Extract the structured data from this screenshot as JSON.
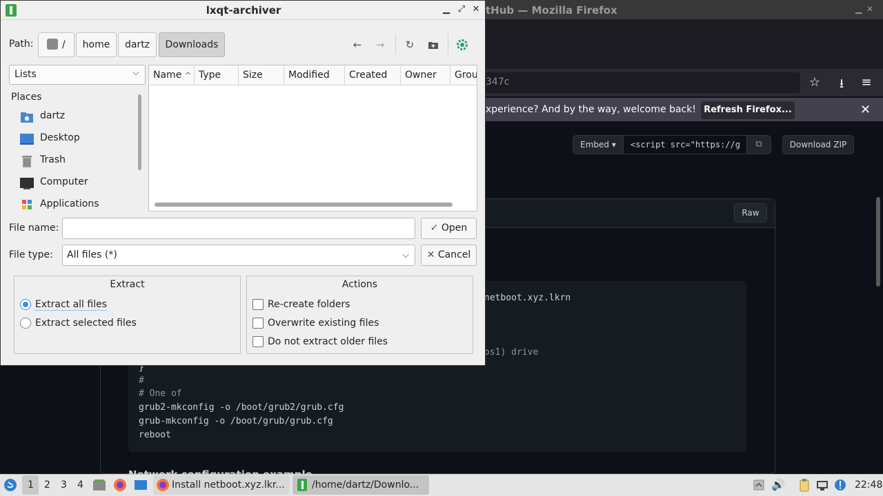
{
  "firefox": {
    "title": "tHub — Mozilla Firefox",
    "url_fragment": "347c",
    "notification_text": "xperience? And by the way, welcome back!",
    "refresh_button": "Refresh Firefox...",
    "embed_button": "Embed ▾",
    "embed_value": "<script src=\"https://g",
    "download_zip": "Download ZIP",
    "raw_button": "Raw",
    "code_fragments": {
      "line1": "netboot.xyz.lkrn",
      "line2": "os1) drive"
    },
    "code_lines": [
      {
        "text": "}",
        "comment": false
      },
      {
        "text": "#",
        "comment": true
      },
      {
        "text": "# One of",
        "comment": true
      },
      {
        "text": "grub2-mkconfig -o /boot/grub2/grub.cfg",
        "comment": false
      },
      {
        "text": "grub-mkconfig -o /boot/grub/grub.cfg",
        "comment": false
      },
      {
        "text": "reboot",
        "comment": false
      }
    ],
    "heading_below": "Network configuration example"
  },
  "dialog": {
    "title": "lxqt-archiver",
    "path_label": "Path:",
    "path_crumbs": [
      "/",
      "home",
      "dartz",
      "Downloads"
    ],
    "active_crumb": "Downloads",
    "places_view": "Lists",
    "places_heading": "Places",
    "places": [
      {
        "label": "dartz",
        "icon": "home-folder-icon"
      },
      {
        "label": "Desktop",
        "icon": "desktop-icon"
      },
      {
        "label": "Trash",
        "icon": "trash-icon"
      },
      {
        "label": "Computer",
        "icon": "computer-icon"
      },
      {
        "label": "Applications",
        "icon": "applications-icon"
      }
    ],
    "columns": [
      "Name",
      "Type",
      "Size",
      "Modified",
      "Created",
      "Owner",
      "Group"
    ],
    "sort_column": "Name",
    "file_name_label": "File name:",
    "file_name_value": "",
    "file_type_label": "File type:",
    "file_type_value": "All files (*)",
    "open_button": "Open",
    "cancel_button": "Cancel",
    "extract_group": {
      "title": "Extract",
      "options": [
        {
          "label": "Extract all files",
          "checked": true
        },
        {
          "label": "Extract selected files",
          "checked": false
        }
      ]
    },
    "actions_group": {
      "title": "Actions",
      "options": [
        {
          "label": "Re-create folders",
          "checked": false
        },
        {
          "label": "Overwrite existing files",
          "checked": false
        },
        {
          "label": "Do not extract older files",
          "checked": false
        }
      ]
    }
  },
  "taskbar": {
    "workspaces": [
      "1",
      "2",
      "3",
      "4"
    ],
    "active_workspace": "1",
    "tasks": [
      {
        "label": "Install netboot.xyz.lkr...",
        "icon": "firefox-icon"
      },
      {
        "label": "/home/dartz/Downlo...",
        "icon": "archiver-icon"
      }
    ],
    "clock": "22:48"
  },
  "colors": {
    "accent": "#3a8ee6",
    "github_bg": "#0d1117",
    "dialog_bg": "#efefef",
    "archiver_green": "#3aa646"
  }
}
